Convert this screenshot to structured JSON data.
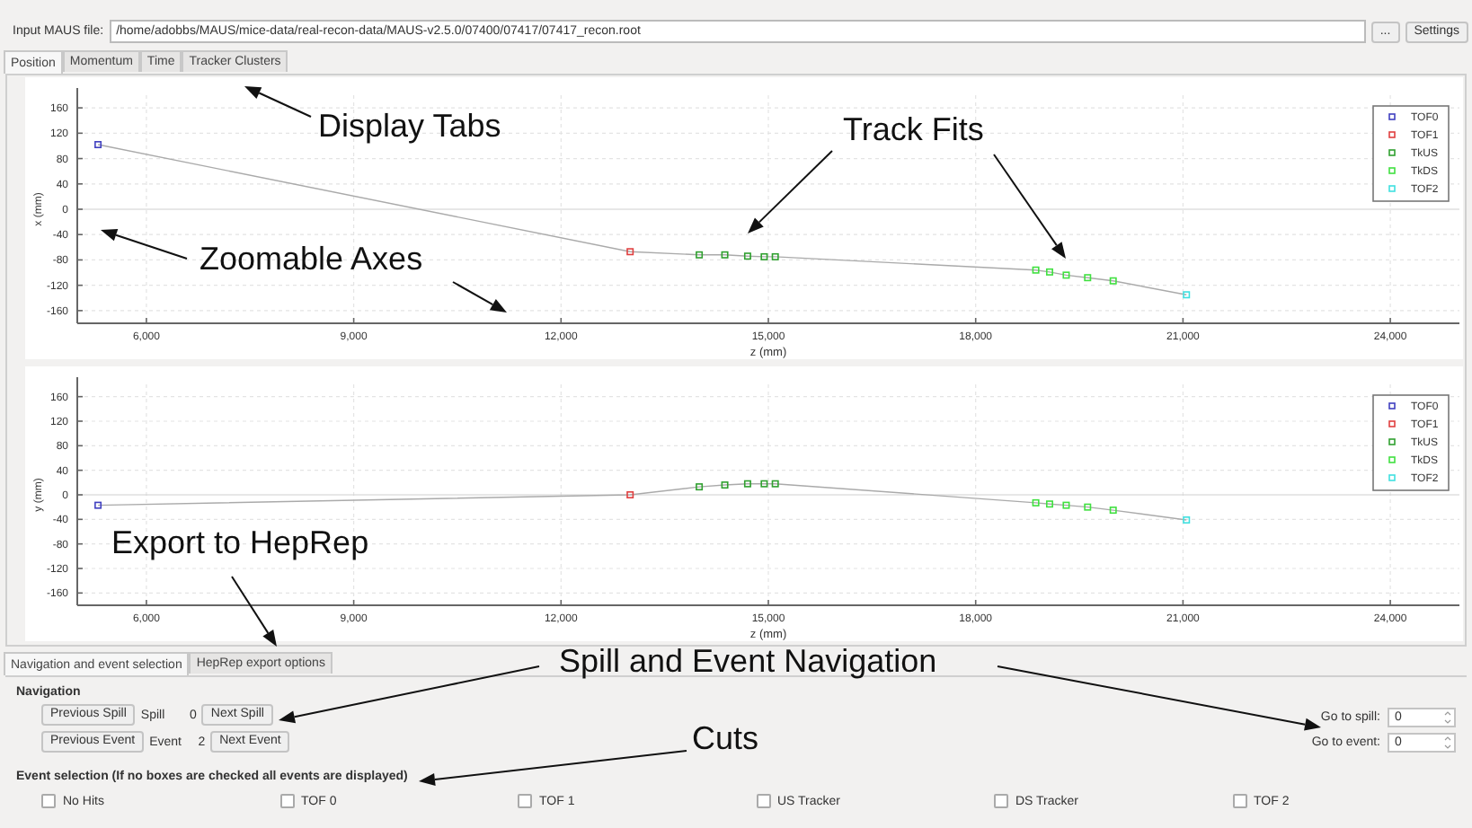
{
  "file_row": {
    "label": "Input MAUS file:",
    "value": "/home/adobbs/MAUS/mice-data/real-recon-data/MAUS-v2.5.0/07400/07417/07417_recon.root",
    "browse_button": "...",
    "settings_button": "Settings"
  },
  "display_tabs": [
    {
      "label": "Position",
      "selected": true
    },
    {
      "label": "Momentum",
      "selected": false
    },
    {
      "label": "Time",
      "selected": false
    },
    {
      "label": "Tracker Clusters",
      "selected": false
    }
  ],
  "plots": [
    {
      "chart_data": {
        "type": "scatter",
        "xlabel": "z (mm)",
        "ylabel": "x (mm)",
        "x": [
          5300,
          13000,
          14000,
          14370,
          14700,
          14940,
          15100,
          18870,
          19070,
          19310,
          19620,
          19990,
          21050
        ],
        "xlim": [
          5000,
          25000
        ],
        "ylim": [
          -180,
          180
        ],
        "xticks": [
          {
            "value": 6000,
            "label": "6,000"
          },
          {
            "value": 9000,
            "label": "9,000"
          },
          {
            "value": 12000,
            "label": "12,000"
          },
          {
            "value": 15000,
            "label": "15,000"
          },
          {
            "value": 18000,
            "label": "18,000"
          },
          {
            "value": 21000,
            "label": "21,000"
          },
          {
            "value": 24000,
            "label": "24,000"
          }
        ],
        "yticks": [
          160,
          120,
          80,
          40,
          0,
          -40,
          -80,
          -120,
          -160
        ],
        "grid": true,
        "legend": true,
        "series": [
          {
            "type": "line",
            "color": "#aaaaaa",
            "values": [
              102,
              -67,
              -72,
              -72,
              -74,
              -75,
              -75,
              -96,
              -99,
              -104,
              -108,
              -113,
              -135
            ]
          },
          {
            "name": "TOF0",
            "color": "#4040c0",
            "values": [
              102,
              null,
              null,
              null,
              null,
              null,
              null,
              null,
              null,
              null,
              null,
              null,
              null
            ]
          },
          {
            "name": "TOF1",
            "color": "#e04040",
            "values": [
              null,
              -67,
              null,
              null,
              null,
              null,
              null,
              null,
              null,
              null,
              null,
              null,
              null
            ]
          },
          {
            "name": "TkUS",
            "color": "#30a030",
            "values": [
              null,
              null,
              -72,
              -72,
              -74,
              -75,
              -75,
              null,
              null,
              null,
              null,
              null,
              null
            ]
          },
          {
            "name": "TkDS",
            "color": "#40e040",
            "values": [
              null,
              null,
              null,
              null,
              null,
              null,
              null,
              -96,
              -99,
              -104,
              -108,
              -113,
              null
            ]
          },
          {
            "name": "TOF2",
            "color": "#40e0e0",
            "values": [
              null,
              null,
              null,
              null,
              null,
              null,
              null,
              null,
              null,
              null,
              null,
              null,
              -135
            ]
          }
        ]
      }
    },
    {
      "chart_data": {
        "type": "scatter",
        "xlabel": "z (mm)",
        "ylabel": "y (mm)",
        "x": [
          5300,
          13000,
          14000,
          14370,
          14700,
          14940,
          15100,
          18870,
          19070,
          19310,
          19620,
          19990,
          21050
        ],
        "xlim": [
          5000,
          25000
        ],
        "ylim": [
          -180,
          180
        ],
        "xticks": [
          {
            "value": 6000,
            "label": "6,000"
          },
          {
            "value": 9000,
            "label": "9,000"
          },
          {
            "value": 12000,
            "label": "12,000"
          },
          {
            "value": 15000,
            "label": "15,000"
          },
          {
            "value": 18000,
            "label": "18,000"
          },
          {
            "value": 21000,
            "label": "21,000"
          },
          {
            "value": 24000,
            "label": "24,000"
          }
        ],
        "yticks": [
          160,
          120,
          80,
          40,
          0,
          -40,
          -80,
          -120,
          -160
        ],
        "grid": true,
        "legend": true,
        "series": [
          {
            "type": "line",
            "color": "#aaaaaa",
            "values": [
              -17,
              0,
              13,
              16,
              18,
              18,
              18,
              -13,
              -15,
              -17,
              -20,
              -25,
              -41
            ]
          },
          {
            "name": "TOF0",
            "color": "#4040c0",
            "values": [
              -17,
              null,
              null,
              null,
              null,
              null,
              null,
              null,
              null,
              null,
              null,
              null,
              null
            ]
          },
          {
            "name": "TOF1",
            "color": "#e04040",
            "values": [
              null,
              0,
              null,
              null,
              null,
              null,
              null,
              null,
              null,
              null,
              null,
              null,
              null
            ]
          },
          {
            "name": "TkUS",
            "color": "#30a030",
            "values": [
              null,
              null,
              13,
              16,
              18,
              18,
              18,
              null,
              null,
              null,
              null,
              null,
              null
            ]
          },
          {
            "name": "TkDS",
            "color": "#40e040",
            "values": [
              null,
              null,
              null,
              null,
              null,
              null,
              null,
              -13,
              -15,
              -17,
              -20,
              -25,
              null
            ]
          },
          {
            "name": "TOF2",
            "color": "#40e0e0",
            "values": [
              null,
              null,
              null,
              null,
              null,
              null,
              null,
              null,
              null,
              null,
              null,
              null,
              -41
            ]
          }
        ]
      }
    }
  ],
  "panel_tabs": [
    {
      "label": "Navigation and event selection",
      "selected": true
    },
    {
      "label": "HepRep export options",
      "selected": false
    }
  ],
  "navigation": {
    "title": "Navigation",
    "rows": [
      {
        "previous": "Previous Spill",
        "label": "Spill",
        "value": "0",
        "next": "Next Spill"
      },
      {
        "previous": "Previous Event",
        "label": "Event",
        "value": "2",
        "next": "Next Event"
      }
    ],
    "goto": [
      {
        "label": "Go to spill:",
        "value": "0"
      },
      {
        "label": "Go to event:",
        "value": "0"
      }
    ]
  },
  "event_selection": {
    "title": "Event selection (If no boxes are checked all events are displayed)",
    "options": [
      {
        "label": "No Hits",
        "checked": false
      },
      {
        "label": "TOF 0",
        "checked": false
      },
      {
        "label": "TOF 1",
        "checked": false
      },
      {
        "label": "US Tracker",
        "checked": false
      },
      {
        "label": "DS Tracker",
        "checked": false
      },
      {
        "label": "TOF 2",
        "checked": false
      }
    ]
  },
  "annotations": [
    {
      "text": "Display Tabs"
    },
    {
      "text": "Track Fits"
    },
    {
      "text": "Zoomable Axes"
    },
    {
      "text": "Export to HepRep"
    },
    {
      "text": "Spill and Event Navigation"
    },
    {
      "text": "Cuts"
    }
  ]
}
